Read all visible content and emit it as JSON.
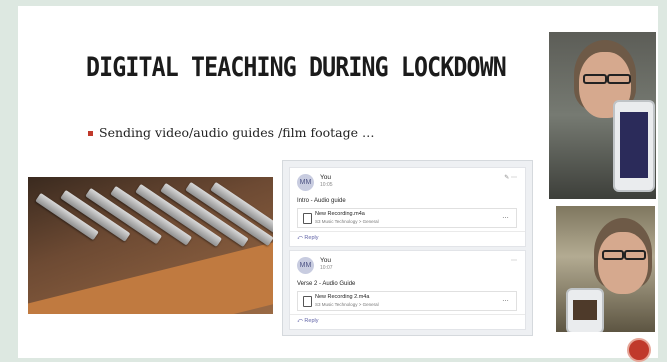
{
  "slide": {
    "title": "DIGITAL TEACHING DURING LOCKDOWN",
    "bullet": "Sending video/audio guides /film footage …"
  },
  "teams": {
    "posts": [
      {
        "avatar": "MM",
        "author": "You",
        "time": "10:05",
        "title": "Intro - Audio guide",
        "file_name": "New Recording.m4a",
        "file_path": "S3 Music Technology > General",
        "reply": "Reply"
      },
      {
        "avatar": "MM",
        "author": "You",
        "time": "10:07",
        "title": "Verse 2 - Audio Guide",
        "file_name": "New Recording 2.m4a",
        "file_path": "S3 Music Technology > General",
        "reply": "Reply"
      }
    ],
    "more_icon": "…"
  },
  "colors": {
    "bullet": "#c0392b",
    "background": "#dde8e1",
    "accent": "#6264a7"
  }
}
